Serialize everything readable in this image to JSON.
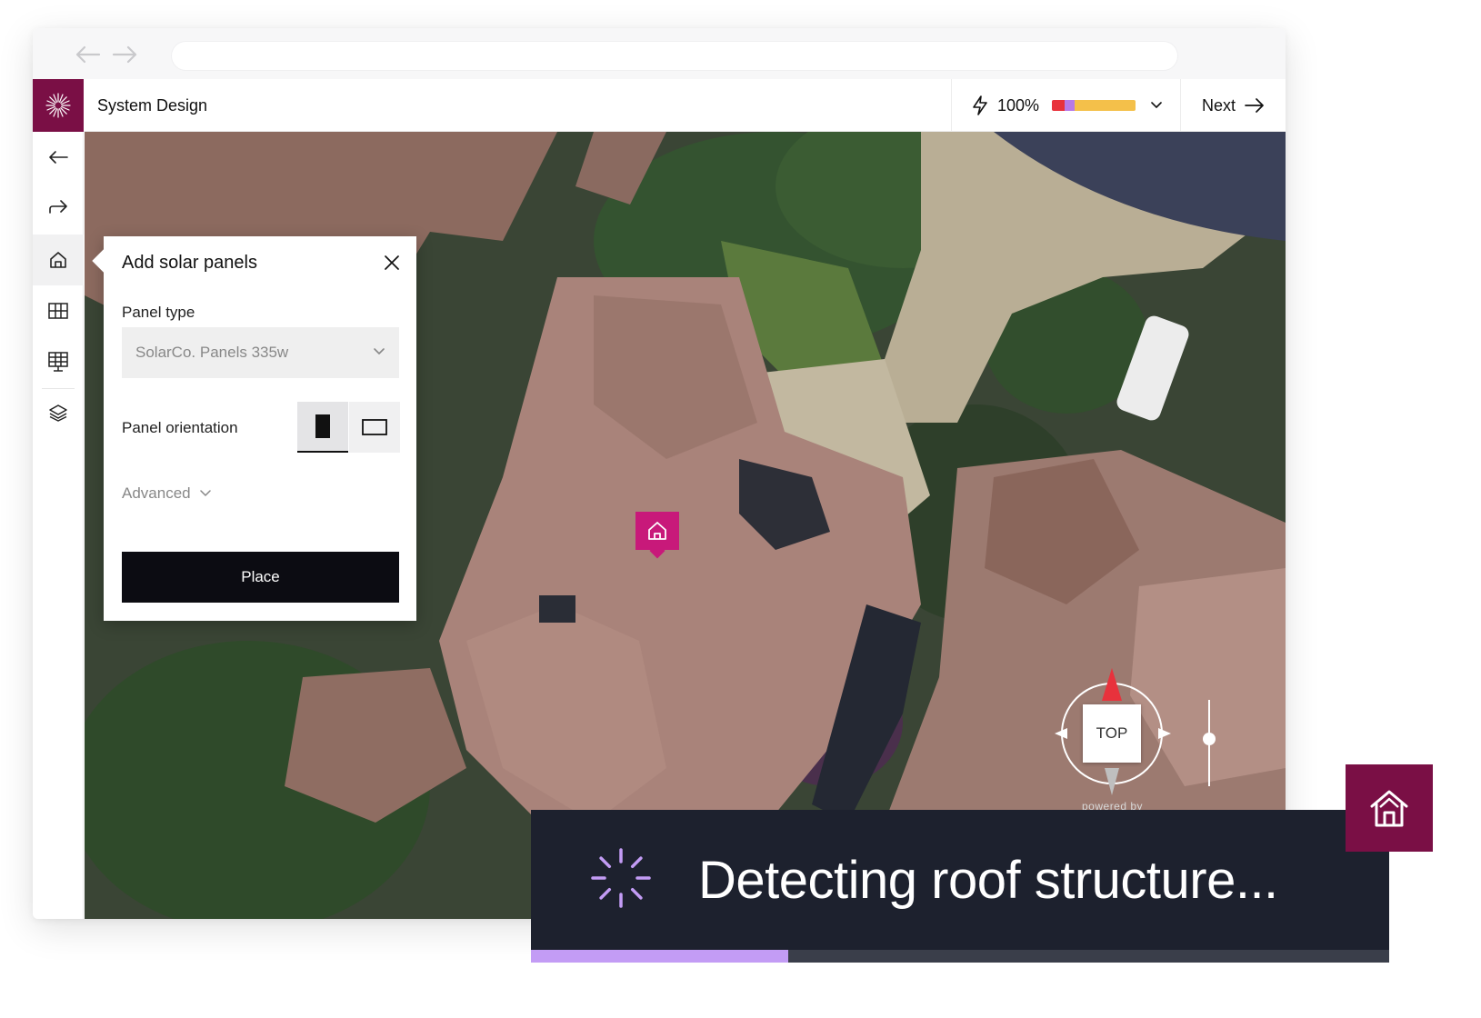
{
  "app": {
    "title": "System Design",
    "brand_color": "#7a0f45"
  },
  "header": {
    "energy_percent": "100%",
    "energy_bar": [
      {
        "color": "#e8323c",
        "fraction": 0.15
      },
      {
        "color": "#b77ae8",
        "fraction": 0.12
      },
      {
        "color": "#f4c04a",
        "fraction": 0.73
      }
    ],
    "next_label": "Next"
  },
  "toolbar": {
    "items": [
      {
        "name": "undo",
        "icon": "undo-arrow-icon"
      },
      {
        "name": "redo",
        "icon": "redo-arrow-icon"
      },
      {
        "name": "house",
        "icon": "home-icon",
        "active": true
      },
      {
        "name": "grid",
        "icon": "grid-icon"
      },
      {
        "name": "panels",
        "icon": "solar-panel-icon"
      },
      {
        "name": "layers",
        "icon": "layers-icon"
      }
    ]
  },
  "panel": {
    "title": "Add solar panels",
    "panel_type_label": "Panel type",
    "panel_type_value": "SolarCo. Panels 335w",
    "orientation_label": "Panel orientation",
    "orientation_selected": "portrait",
    "advanced_label": "Advanced",
    "place_label": "Place"
  },
  "map": {
    "compass_label": "TOP",
    "powered_label": "powered by",
    "pin_color": "#c8197a"
  },
  "toast": {
    "text": "Detecting roof structure...",
    "progress": 0.3,
    "progress_color": "#c39cf5",
    "spinner_color": "#c39cf5"
  }
}
